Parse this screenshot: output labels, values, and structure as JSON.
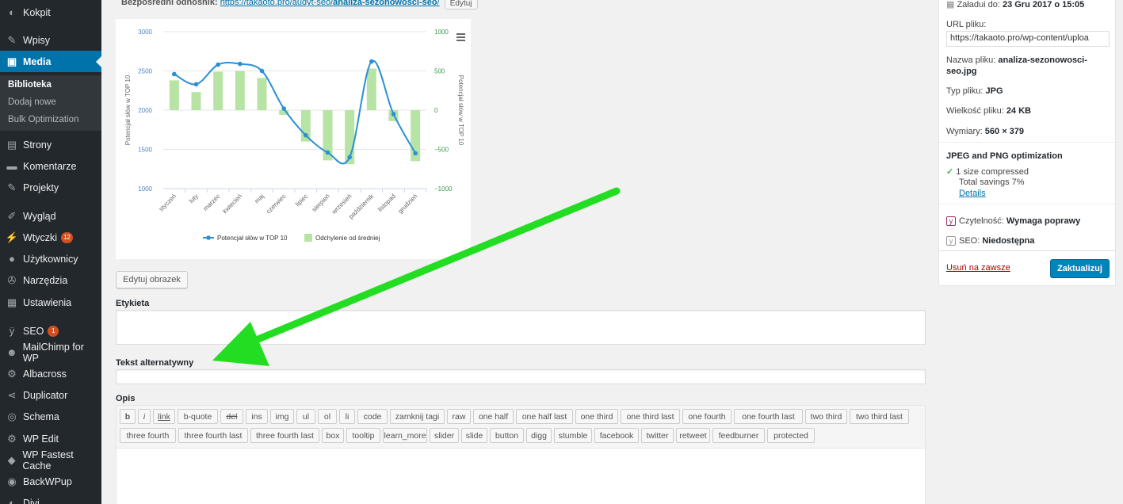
{
  "sidebar": {
    "items": [
      {
        "label": "Kokpit",
        "icon": "dashboard-icon",
        "glyph": "◐"
      },
      {
        "label": "Wpisy",
        "icon": "pin-icon",
        "glyph": "✎"
      },
      {
        "label": "Media",
        "icon": "media-icon",
        "glyph": "▣"
      },
      {
        "label": "Strony",
        "icon": "pages-icon",
        "glyph": "▤"
      },
      {
        "label": "Komentarze",
        "icon": "comments-icon",
        "glyph": "▬"
      },
      {
        "label": "Projekty",
        "icon": "pin-icon",
        "glyph": "✎"
      },
      {
        "label": "Wygląd",
        "icon": "brush-icon",
        "glyph": "✐"
      },
      {
        "label": "Wtyczki",
        "icon": "plugins-icon",
        "glyph": "⚡",
        "badge": "12"
      },
      {
        "label": "Użytkownicy",
        "icon": "users-icon",
        "glyph": "●"
      },
      {
        "label": "Narzędzia",
        "icon": "tools-icon",
        "glyph": "✇"
      },
      {
        "label": "Ustawienia",
        "icon": "settings-icon",
        "glyph": "▦"
      },
      {
        "label": "SEO",
        "icon": "yoast-icon",
        "glyph": "ÿ",
        "badge": "1"
      },
      {
        "label": "MailChimp for WP",
        "icon": "mailchimp-icon",
        "glyph": "☻"
      },
      {
        "label": "Albacross",
        "icon": "gear-icon",
        "glyph": "⚙"
      },
      {
        "label": "Duplicator",
        "icon": "share-icon",
        "glyph": "⋖"
      },
      {
        "label": "Schema",
        "icon": "compass-icon",
        "glyph": "◎"
      },
      {
        "label": "WP Edit",
        "icon": "gear-icon",
        "glyph": "⚙"
      },
      {
        "label": "WP Fastest Cache",
        "icon": "cheetah-icon",
        "glyph": "◆"
      },
      {
        "label": "BackWPup",
        "icon": "backup-icon",
        "glyph": "◉"
      },
      {
        "label": "Divi",
        "icon": "divi-icon",
        "glyph": "◐"
      }
    ],
    "submenu": [
      "Biblioteka",
      "Dodaj nowe",
      "Bulk Optimization"
    ]
  },
  "main": {
    "direct_link_label": "Bezpośredni odnośnik:",
    "direct_link_prefix": "https://takaoto.pro/audyt-seo/",
    "direct_link_bold": "analiza-sezonowosci-seo",
    "direct_link_suffix": "/",
    "direct_link_edit": "Edytuj",
    "edit_image_button": "Edytuj obrazek",
    "caption_label": "Etykieta",
    "alt_label": "Tekst alternatywny",
    "description_label": "Opis",
    "quicktags": [
      [
        "b",
        "i",
        "link",
        "b-quote",
        "del",
        "ins",
        "img",
        "ul",
        "ol",
        "li",
        "code",
        "zamknij tagi",
        "raw",
        "one half",
        "one half last",
        "one third",
        "one third last",
        "one fourth",
        "one fourth last",
        "two third",
        "two third last"
      ],
      [
        "three fourth",
        "three fourth last",
        "three fourth last",
        "box",
        "tooltip",
        "learn_more",
        "slider",
        "slide",
        "button",
        "digg",
        "stumble",
        "facebook",
        "twitter",
        "retweet",
        "feedburner",
        "protected"
      ]
    ]
  },
  "side": {
    "uploaded_label": "Załadui do:",
    "uploaded_value": "23 Gru 2017 o 15:05",
    "file_url_label": "URL pliku:",
    "file_url_value": "https://takaoto.pro/wp-content/uploa",
    "filename_label": "Nazwa pliku:",
    "filename_value_1": "analiza-sezonowosci-",
    "filename_value_2": "seo.jpg",
    "filetype_label": "Typ pliku:",
    "filetype_value": "JPG",
    "filesize_label": "Wielkość pliku:",
    "filesize_value": "24 KB",
    "dimensions_label": "Wymiary:",
    "dimensions_value": "560 × 379",
    "optim_title": "JPEG and PNG optimization",
    "optim_compressed": "1 size compressed",
    "optim_savings": "Total savings 7%",
    "optim_details": "Details",
    "readability_label": "Czytelność:",
    "readability_value": "Wymaga poprawy",
    "seo_label": "SEO:",
    "seo_value": "Niedostępna",
    "delete_link": "Usuń na zawsze",
    "update_button": "Zaktualizuj"
  },
  "colors": {
    "arrow": "#22dd22",
    "line": "#2b8fd6",
    "bar": "#b7e4a4",
    "accent": "#0073aa"
  },
  "chart_data": {
    "type": "bar",
    "categories": [
      "styczeń",
      "luty",
      "marzec",
      "kwiecień",
      "maj",
      "czerwiec",
      "lipiec",
      "sierpień",
      "wrzesień",
      "październik",
      "listopad",
      "grudzień"
    ],
    "series": [
      {
        "name": "Potencjał słów w TOP 10",
        "type": "line",
        "axis": "left",
        "values": [
          2460,
          2330,
          2580,
          2590,
          2500,
          2020,
          1680,
          1460,
          1400,
          2620,
          1950,
          1450
        ]
      },
      {
        "name": "Odchylenie od średniej",
        "type": "bar",
        "axis": "right",
        "values": [
          380,
          230,
          490,
          500,
          410,
          -60,
          -400,
          -640,
          -690,
          530,
          -140,
          -650
        ]
      }
    ],
    "ylabel_left": "Potencjał słów w TOP 10",
    "ylabel_right": "Potencjał słów w TOP 10",
    "y_left_ticks": [
      "3000",
      "2500",
      "2000",
      "1500",
      "1000"
    ],
    "y_right_ticks": [
      "1000",
      "500",
      "0",
      "−500",
      "−1000"
    ],
    "ylim_left": [
      1000,
      3000
    ],
    "ylim_right": [
      -1000,
      1000
    ],
    "grid": true,
    "legend": "bottom"
  }
}
